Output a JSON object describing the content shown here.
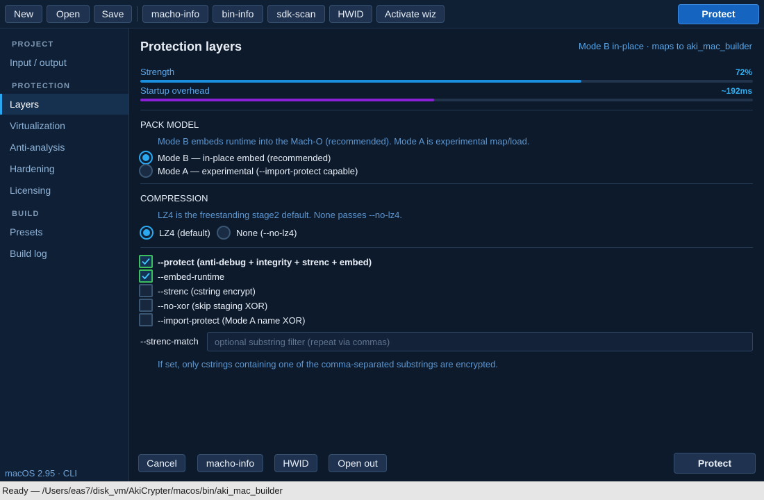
{
  "toolbar": {
    "buttons": [
      "New",
      "Open",
      "Save",
      "macho-info",
      "bin-info",
      "sdk-scan",
      "HWID",
      "Activate wiz"
    ],
    "protect_label": "Protect"
  },
  "sidebar": {
    "sections": [
      "PROJECT",
      "PROTECTION",
      "BUILD"
    ],
    "items": [
      "Input / output",
      "Layers",
      "Virtualization",
      "Anti-analysis",
      "Hardening",
      "Licensing",
      "Presets",
      "Build log"
    ],
    "active": "Layers",
    "footer": "macOS 2.95 · CLI"
  },
  "main": {
    "title": "Protection layers",
    "subtitle": "Mode B in-place · maps to aki_mac_builder",
    "meters": [
      {
        "label": "Strength",
        "value": "72%",
        "level": 0.72,
        "color": "#1a8fe0"
      },
      {
        "label": "Startup overhead",
        "value": "~192ms",
        "level": 0.48,
        "color": "#8b1fd8"
      }
    ],
    "pack_model": {
      "heading": "PACK MODEL",
      "hint": "Mode B embeds runtime into the Mach-O (recommended). Mode A is experimental map/load.",
      "options": [
        {
          "label": "Mode B — in-place embed (recommended)",
          "selected": true
        },
        {
          "label": "Mode A — experimental (--import-protect capable)",
          "selected": false
        }
      ]
    },
    "compression": {
      "heading": "COMPRESSION",
      "hint": "LZ4 is the freestanding stage2 default. None passes --no-lz4.",
      "options": [
        {
          "label": "LZ4 (default)",
          "selected": true
        },
        {
          "label": "None (--no-lz4)",
          "selected": false
        }
      ]
    },
    "flags": [
      {
        "label": "--protect (anti-debug + integrity + strenc + embed)",
        "checked": true
      },
      {
        "label": "--embed-runtime",
        "checked": true
      },
      {
        "label": "--strenc (cstring encrypt)",
        "checked": false
      },
      {
        "label": "--no-xor (skip staging XOR)",
        "checked": false
      },
      {
        "label": "--import-protect (Mode A name XOR)",
        "checked": false
      }
    ],
    "strenc_match": {
      "label": "--strenc-match",
      "value": "",
      "placeholder": "optional substring filter (repeat via commas)",
      "hint": "If set, only cstrings containing one of the comma-separated substrings are encrypted."
    }
  },
  "footer": {
    "buttons": [
      "Cancel",
      "macho-info",
      "HWID",
      "Open out"
    ],
    "protect_label": "Protect"
  },
  "status": {
    "text": "Ready — /Users/eas7/disk_vm/AkiCrypter/macos/bin/aki_mac_builder"
  }
}
